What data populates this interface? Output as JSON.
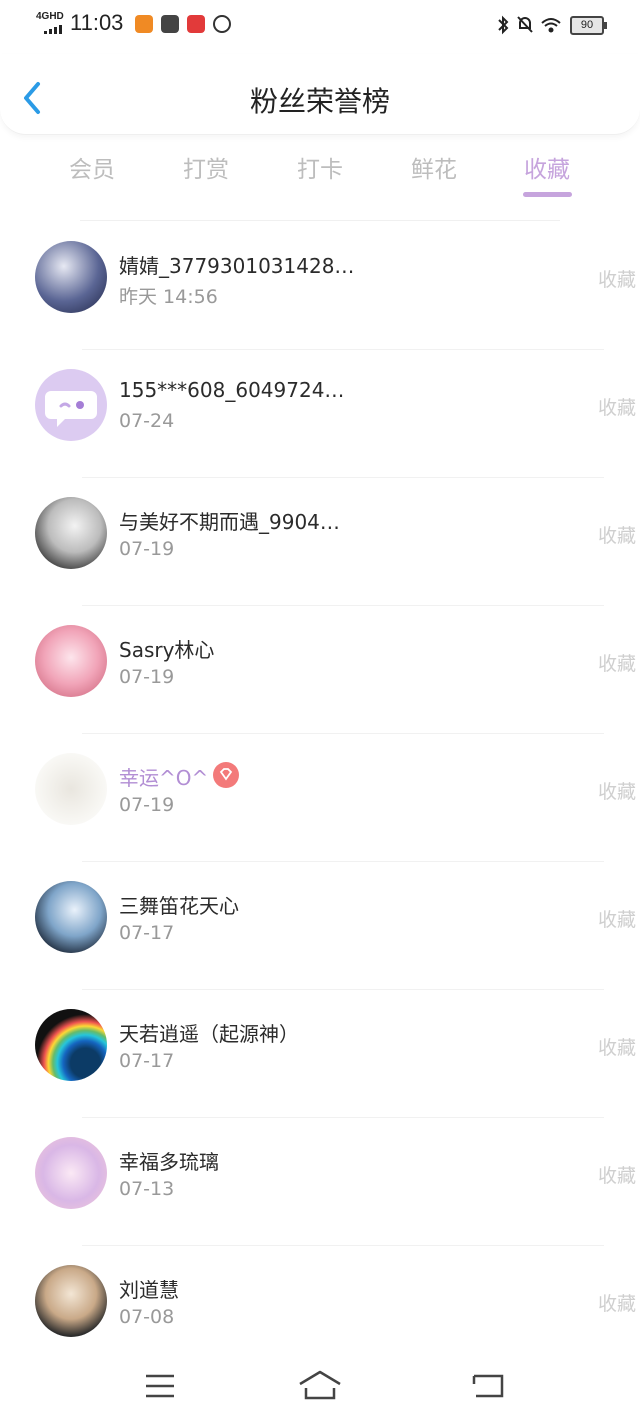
{
  "status_bar": {
    "network": "4GHD",
    "time": "11:03",
    "battery": "90",
    "icons": [
      "bluetooth-icon",
      "mute-icon",
      "wifi-icon"
    ]
  },
  "header": {
    "title": "粉丝荣誉榜"
  },
  "tabs": [
    {
      "label": "会员"
    },
    {
      "label": "打赏"
    },
    {
      "label": "打卡"
    },
    {
      "label": "鲜花"
    },
    {
      "label": "收藏",
      "active": true
    }
  ],
  "list": [
    {
      "name": "婧婧_3779301031428…",
      "time": "昨天 14:56",
      "action": "收藏"
    },
    {
      "name": "155***608_6049724…",
      "time": "07-24",
      "action": "收藏"
    },
    {
      "name": "与美好不期而遇_9904…",
      "time": "07-19",
      "action": "收藏"
    },
    {
      "name": "Sasry林心",
      "time": "07-19",
      "action": "收藏"
    },
    {
      "name": "幸运^O^",
      "time": "07-19",
      "action": "收藏",
      "vip": true
    },
    {
      "name": "三舞笛花天心",
      "time": "07-17",
      "action": "收藏"
    },
    {
      "name": "天若逍遥（起源神）",
      "time": "07-17",
      "action": "收藏"
    },
    {
      "name": "幸福多琉璃",
      "time": "07-13",
      "action": "收藏"
    },
    {
      "name": "刘道慧",
      "time": "07-08",
      "action": "收藏"
    }
  ],
  "colors": {
    "accent": "#c6a4dd",
    "vip_name": "#b28ed4",
    "vip_badge": "#f37a7a"
  }
}
